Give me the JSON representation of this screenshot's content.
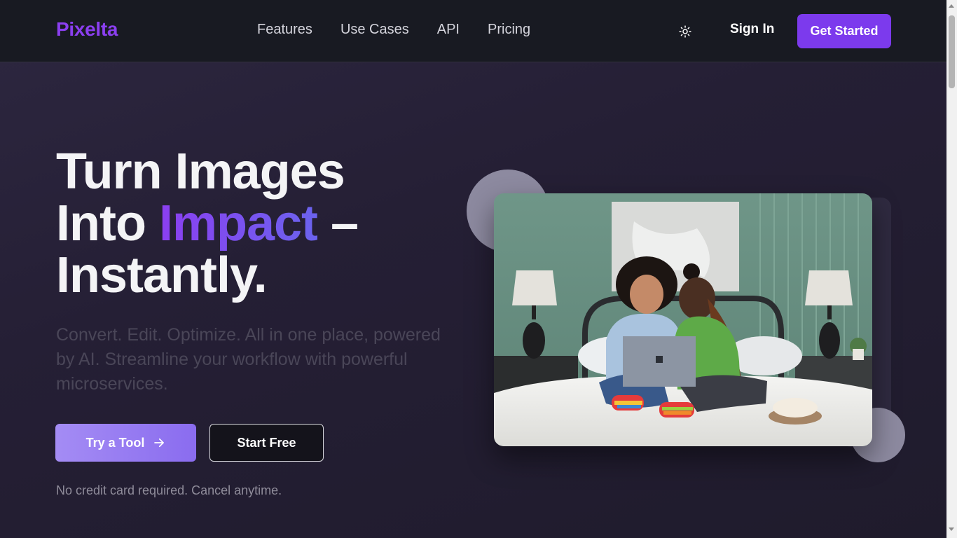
{
  "header": {
    "logo": "Pixelta",
    "nav": [
      "Features",
      "Use Cases",
      "API",
      "Pricing"
    ],
    "theme_icon": "sun-icon",
    "sign_in": "Sign In",
    "get_started": "Get Started"
  },
  "hero": {
    "title_line1": "Turn Images",
    "title_line2_prefix": "Into ",
    "title_accent": "Impact",
    "title_line2_suffix": " –",
    "title_line3": "Instantly.",
    "subtitle": "Convert. Edit. Optimize. All in one place, powered by AI. Streamline your workflow with powerful microservices.",
    "primary_button": "Try a Tool",
    "primary_button_icon": "arrow-right-icon",
    "secondary_button": "Start Free",
    "note": "No credit card required. Cancel anytime."
  },
  "colors": {
    "brand": "#7c3aed",
    "accent_gradient_start": "#8b3ff0",
    "accent_gradient_end": "#6b63ee",
    "header_bg": "#181a22",
    "hero_bg": "#251f35"
  }
}
